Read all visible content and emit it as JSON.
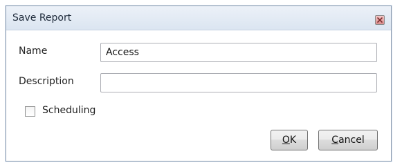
{
  "dialog": {
    "title": "Save Report"
  },
  "form": {
    "name_label": "Name",
    "name_value": "Access",
    "description_label": "Description",
    "description_value": "",
    "scheduling_label": "Scheduling",
    "scheduling_checked": false
  },
  "buttons": {
    "ok_mnemonic": "O",
    "ok_rest": "K",
    "cancel_mnemonic": "C",
    "cancel_rest": "ancel"
  },
  "icons": {
    "close": "close-icon",
    "checkbox": "checkbox-unchecked"
  },
  "colors": {
    "titlebar": "#dbe5f1",
    "close_button": "#d98c8c"
  }
}
